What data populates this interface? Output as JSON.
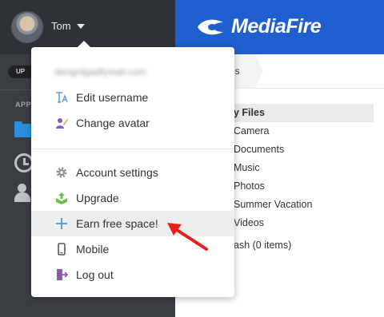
{
  "sidebar": {
    "user_name": "Tom",
    "upgrade_label": "UP",
    "apps_heading": "APP"
  },
  "header": {
    "logo_text": "MediaFire",
    "brand_color": "#1f5fd0"
  },
  "breadcrumb": {
    "label": "es"
  },
  "file_list": {
    "items": [
      "y Files",
      "Camera",
      "Documents",
      "Music",
      "Photos",
      "Summer Vacation",
      "Videos",
      "ash (0 items)"
    ]
  },
  "dropdown": {
    "email": "dengrdgadfymail.com",
    "items": [
      {
        "label": "Edit username",
        "icon": "text-cursor-icon"
      },
      {
        "label": "Change avatar",
        "icon": "person-pen-icon"
      },
      {
        "label": "Account settings",
        "icon": "gear-icon"
      },
      {
        "label": "Upgrade",
        "icon": "upgrade-box-icon"
      },
      {
        "label": "Earn free space!",
        "icon": "plus-icon"
      },
      {
        "label": "Mobile",
        "icon": "phone-icon"
      },
      {
        "label": "Log out",
        "icon": "logout-door-icon"
      }
    ]
  },
  "annotation": {
    "arrow_color": "#e8201a"
  }
}
